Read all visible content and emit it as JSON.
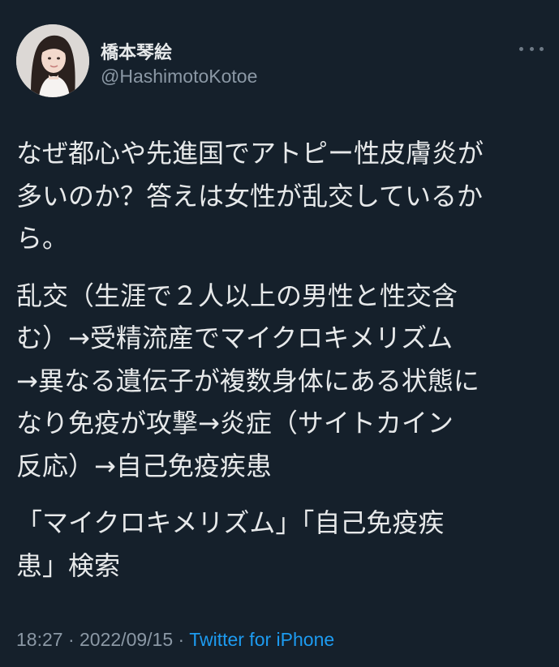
{
  "author": {
    "display_name": "橋本琴絵",
    "handle": "@HashimotoKotoe",
    "avatar_icon": "profile-photo"
  },
  "more_icon": "more-options-icon",
  "tweet": {
    "paragraphs": [
      "なぜ都心や先進国でアトピー性皮膚炎が\n多いのか？答えは女性が乱交しているか\nら。",
      "乱交（生涯で２人以上の男性と性交含\nむ）→受精流産でマイクロキメリズム\n→異なる遺伝子が複数身体にある状態に\nなり免疫が攻撃→炎症（サイトカイン\n反応）→自己免疫疾患",
      "「マイクロキメリズム」「自己免疫疾\n患」検索"
    ]
  },
  "meta": {
    "time": "18:27",
    "separator": "·",
    "date": "2022/09/15",
    "source": "Twitter for iPhone"
  },
  "colors": {
    "background": "#15202b",
    "text": "#e7e9ea",
    "secondary": "#8b98a5",
    "link": "#1d9bf0"
  }
}
